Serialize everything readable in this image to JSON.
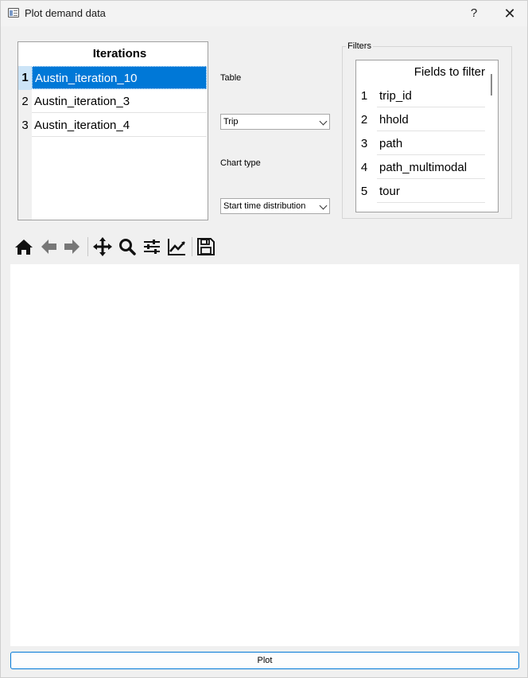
{
  "window": {
    "title": "Plot demand data",
    "help_label": "?",
    "close_label": "✕"
  },
  "iterations": {
    "header": "Iterations",
    "rows": [
      {
        "num": "1",
        "name": "Austin_iteration_10",
        "selected": true
      },
      {
        "num": "2",
        "name": "Austin_iteration_3",
        "selected": false
      },
      {
        "num": "3",
        "name": "Austin_iteration_4",
        "selected": false
      }
    ]
  },
  "table_select": {
    "label": "Table",
    "value": "Trip"
  },
  "chart_type_select": {
    "label": "Chart type",
    "value": "Start time distribution"
  },
  "filters": {
    "title": "Filters",
    "header": "Fields to filter",
    "rows": [
      {
        "num": "1",
        "name": "trip_id"
      },
      {
        "num": "2",
        "name": "hhold"
      },
      {
        "num": "3",
        "name": "path"
      },
      {
        "num": "4",
        "name": "path_multimodal"
      },
      {
        "num": "5",
        "name": "tour"
      }
    ]
  },
  "toolbar": {
    "buttons": [
      "home-icon",
      "back-arrow-icon",
      "forward-arrow-icon",
      "pan-move-icon",
      "zoom-magnifier-icon",
      "configure-subplots-icon",
      "edit-axes-icon",
      "save-disk-icon"
    ]
  },
  "plot_button": {
    "label": "Plot"
  },
  "colors": {
    "selection": "#0078d7",
    "selection_header": "#cce4f7",
    "window_bg": "#f0f0f0"
  }
}
